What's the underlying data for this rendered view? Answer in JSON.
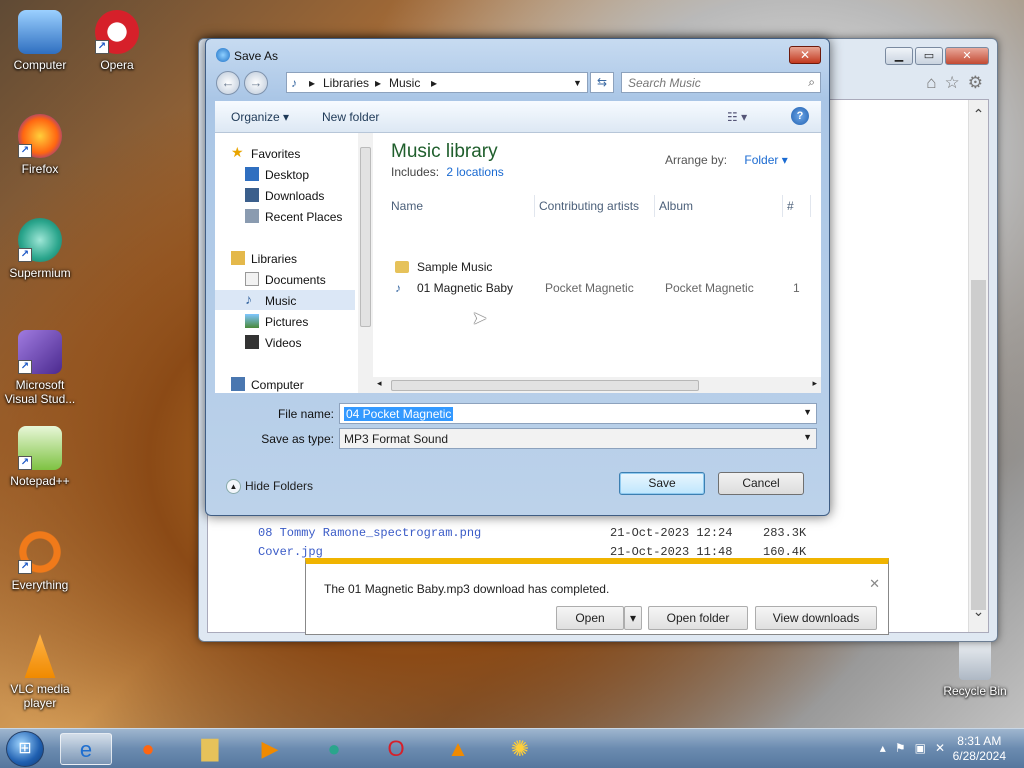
{
  "desktop": {
    "icons": [
      {
        "label": "Computer",
        "icon": "computer-icon",
        "color": "#3a7fd0"
      },
      {
        "label": "Opera",
        "icon": "opera-icon",
        "color": "#d6202a"
      },
      {
        "label": "Firefox",
        "icon": "firefox-icon",
        "color": "#ff7a1a"
      },
      {
        "label": "Supermium",
        "icon": "supermium-icon",
        "color": "#2aa58c"
      },
      {
        "label": "Microsoft Visual Stud...",
        "icon": "visual-studio-icon",
        "color": "#6a3fb5"
      },
      {
        "label": "Notepad++",
        "icon": "notepadpp-icon",
        "color": "#7ec242"
      },
      {
        "label": "Everything",
        "icon": "everything-icon",
        "color": "#f07a1a"
      },
      {
        "label": "VLC media player",
        "icon": "vlc-icon",
        "color": "#f08a00"
      },
      {
        "label": "Recycle Bin",
        "icon": "recycle-bin-icon",
        "color": "#c9d2dc"
      }
    ]
  },
  "browser": {
    "files": [
      {
        "name": "08 Tommy Ramone_spectrogram.png",
        "date": "21-Oct-2023 12:24",
        "size": "283.3K"
      },
      {
        "name": "Cover.jpg",
        "date": "21-Oct-2023 11:48",
        "size": "160.4K"
      }
    ],
    "download_bar": {
      "message": "The 01 Magnetic Baby.mp3 download has completed.",
      "open": "Open",
      "open_folder": "Open folder",
      "view_downloads": "View downloads"
    }
  },
  "dialog": {
    "title": "Save As",
    "breadcrumb": [
      "Libraries",
      "Music"
    ],
    "search_placeholder": "Search Music",
    "toolbar": {
      "organize": "Organize",
      "new_folder": "New folder"
    },
    "nav": {
      "favorites": "Favorites",
      "desktop": "Desktop",
      "downloads": "Downloads",
      "recent": "Recent Places",
      "libraries": "Libraries",
      "documents": "Documents",
      "music": "Music",
      "pictures": "Pictures",
      "videos": "Videos",
      "computer": "Computer"
    },
    "library": {
      "title": "Music library",
      "includes_label": "Includes:",
      "includes_link": "2 locations",
      "arrange_label": "Arrange by:",
      "arrange_value": "Folder"
    },
    "columns": [
      "Name",
      "Contributing artists",
      "Album",
      "#"
    ],
    "rows": [
      {
        "name": "Sample Music",
        "artist": "",
        "album": "",
        "num": ""
      },
      {
        "name": "01 Magnetic Baby",
        "artist": "Pocket Magnetic",
        "album": "Pocket Magnetic",
        "num": "1"
      }
    ],
    "file_name_label": "File name:",
    "file_name_value": "04 Pocket Magnetic",
    "save_type_label": "Save as type:",
    "save_type_value": "MP3 Format Sound",
    "hide_folders": "Hide Folders",
    "save": "Save",
    "cancel": "Cancel"
  },
  "taskbar": {
    "time": "8:31 AM",
    "date": "6/28/2024"
  }
}
